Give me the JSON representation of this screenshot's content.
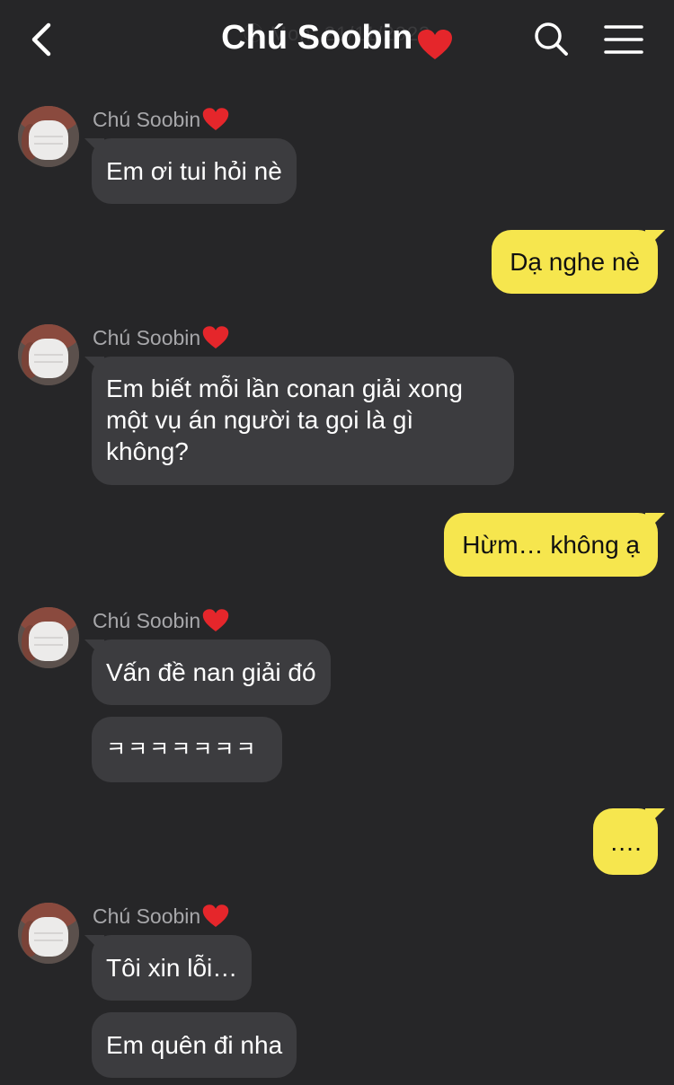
{
  "header": {
    "title": "Chú Soobin",
    "faded_subtitle": "ⓢ Mon, 21/11/2023",
    "heart_icon": "red-heart-icon",
    "back_icon": "chevron-left-icon",
    "search_icon": "search-icon",
    "menu_icon": "hamburger-menu-icon"
  },
  "colors": {
    "background": "#262628",
    "incoming_bubble": "#3c3c3f",
    "outgoing_bubble": "#f6e64e",
    "sender_name": "#a7a7aa",
    "heart": "#e5262b"
  },
  "messages": [
    {
      "sender": "Chú Soobin",
      "direction": "in",
      "text": "Em ơi tui hỏi nè"
    },
    {
      "direction": "out",
      "text": "Dạ nghe nè"
    },
    {
      "sender": "Chú Soobin",
      "direction": "in",
      "lines": [
        "Em biết mỗi lần conan giải xong",
        "một vụ án người ta gọi là gì",
        "không?"
      ]
    },
    {
      "direction": "out",
      "text": "Hừm… không ạ"
    },
    {
      "sender": "Chú Soobin",
      "direction": "in",
      "text": "Vấn đề nan giải đó"
    },
    {
      "direction": "in",
      "text": "ㅋㅋㅋㅋㅋㅋㅋ"
    },
    {
      "direction": "out",
      "text": "…."
    },
    {
      "sender": "Chú Soobin",
      "direction": "in",
      "text": "Tôi xin lỗi…"
    },
    {
      "direction": "in",
      "text": "Em quên đi nha"
    }
  ]
}
